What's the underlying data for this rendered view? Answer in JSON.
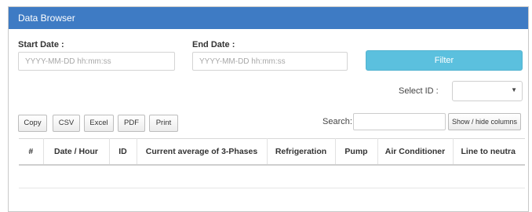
{
  "panel": {
    "title": "Data Browser"
  },
  "filters": {
    "start_label": "Start Date :",
    "start_placeholder": "YYYY-MM-DD hh:mm:ss",
    "end_label": "End Date :",
    "end_placeholder": "YYYY-MM-DD hh:mm:ss",
    "filter_button": "Filter",
    "select_id_label": "Select ID :",
    "select_id_value": ""
  },
  "toolbar": {
    "copy": "Copy",
    "csv": "CSV",
    "excel": "Excel",
    "pdf": "PDF",
    "print": "Print",
    "search_label": "Search:",
    "search_value": "",
    "columns_button": "Show / hide columns"
  },
  "table": {
    "columns": [
      "#",
      "Date / Hour",
      "ID",
      "Current average of 3-Phases",
      "Refrigeration",
      "Pump",
      "Air Conditioner",
      "Line to neutra"
    ]
  },
  "colors": {
    "header": "#3e7bc4",
    "filter_button": "#5bc0de"
  }
}
